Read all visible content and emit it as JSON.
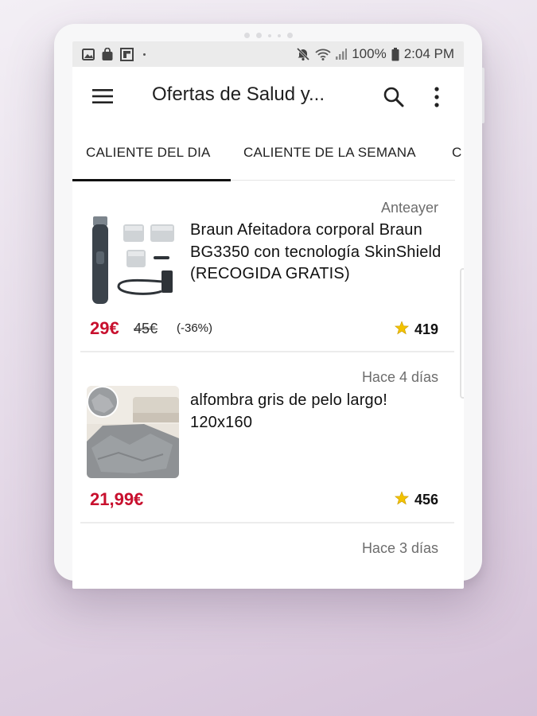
{
  "status_bar": {
    "battery": "100%",
    "time": "2:04 PM"
  },
  "app_bar": {
    "title": "Ofertas de Salud y..."
  },
  "tabs": [
    {
      "label": "CALIENTE DEL DIA",
      "active": true
    },
    {
      "label": "CALIENTE DE LA SEMANA",
      "active": false
    },
    {
      "label": "C",
      "active": false
    }
  ],
  "deals": [
    {
      "date": "Anteayer",
      "title": "Braun Afeitadora corporal Braun BG3350 con tecnología SkinShield (RECOGIDA GRATIS)",
      "price": "29€",
      "old_price": "45€",
      "discount": "(-36%)",
      "votes": "419"
    },
    {
      "date": "Hace 4 días",
      "title": "alfombra gris de pelo largo! 120x160",
      "price": "21,99€",
      "votes": "456"
    },
    {
      "date": "Hace 3 días"
    }
  ],
  "colors": {
    "price": "#c8102e",
    "star": "#f2c200",
    "tab_indicator": "#111111"
  }
}
